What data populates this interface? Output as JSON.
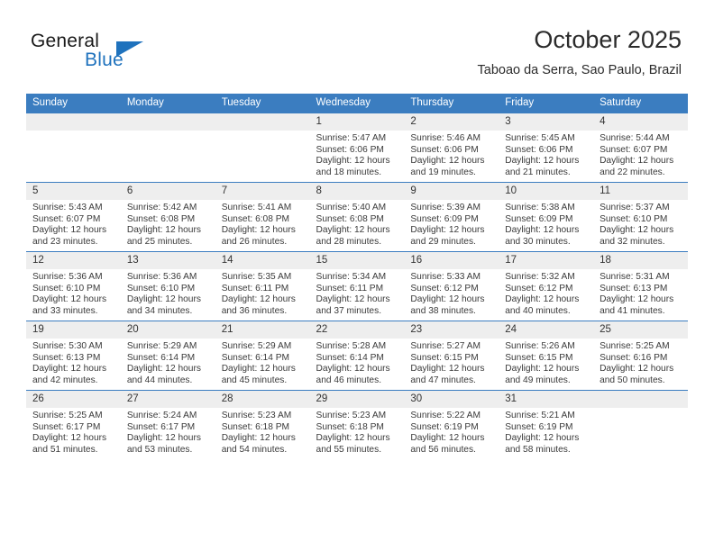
{
  "logo": {
    "word1": "General",
    "word2": "Blue",
    "accent_color": "#1f72bd"
  },
  "header": {
    "month_title": "October 2025",
    "location": "Taboao da Serra, Sao Paulo, Brazil"
  },
  "calendar": {
    "header_color": "#3b7dc0",
    "daynum_bg": "#eeeeee",
    "weekdays": [
      "Sunday",
      "Monday",
      "Tuesday",
      "Wednesday",
      "Thursday",
      "Friday",
      "Saturday"
    ],
    "weeks": [
      [
        {
          "day": "",
          "sunrise": "",
          "sunset": "",
          "daylight_line1": "",
          "daylight_line2": ""
        },
        {
          "day": "",
          "sunrise": "",
          "sunset": "",
          "daylight_line1": "",
          "daylight_line2": ""
        },
        {
          "day": "",
          "sunrise": "",
          "sunset": "",
          "daylight_line1": "",
          "daylight_line2": ""
        },
        {
          "day": "1",
          "sunrise": "Sunrise: 5:47 AM",
          "sunset": "Sunset: 6:06 PM",
          "daylight_line1": "Daylight: 12 hours",
          "daylight_line2": "and 18 minutes."
        },
        {
          "day": "2",
          "sunrise": "Sunrise: 5:46 AM",
          "sunset": "Sunset: 6:06 PM",
          "daylight_line1": "Daylight: 12 hours",
          "daylight_line2": "and 19 minutes."
        },
        {
          "day": "3",
          "sunrise": "Sunrise: 5:45 AM",
          "sunset": "Sunset: 6:06 PM",
          "daylight_line1": "Daylight: 12 hours",
          "daylight_line2": "and 21 minutes."
        },
        {
          "day": "4",
          "sunrise": "Sunrise: 5:44 AM",
          "sunset": "Sunset: 6:07 PM",
          "daylight_line1": "Daylight: 12 hours",
          "daylight_line2": "and 22 minutes."
        }
      ],
      [
        {
          "day": "5",
          "sunrise": "Sunrise: 5:43 AM",
          "sunset": "Sunset: 6:07 PM",
          "daylight_line1": "Daylight: 12 hours",
          "daylight_line2": "and 23 minutes."
        },
        {
          "day": "6",
          "sunrise": "Sunrise: 5:42 AM",
          "sunset": "Sunset: 6:08 PM",
          "daylight_line1": "Daylight: 12 hours",
          "daylight_line2": "and 25 minutes."
        },
        {
          "day": "7",
          "sunrise": "Sunrise: 5:41 AM",
          "sunset": "Sunset: 6:08 PM",
          "daylight_line1": "Daylight: 12 hours",
          "daylight_line2": "and 26 minutes."
        },
        {
          "day": "8",
          "sunrise": "Sunrise: 5:40 AM",
          "sunset": "Sunset: 6:08 PM",
          "daylight_line1": "Daylight: 12 hours",
          "daylight_line2": "and 28 minutes."
        },
        {
          "day": "9",
          "sunrise": "Sunrise: 5:39 AM",
          "sunset": "Sunset: 6:09 PM",
          "daylight_line1": "Daylight: 12 hours",
          "daylight_line2": "and 29 minutes."
        },
        {
          "day": "10",
          "sunrise": "Sunrise: 5:38 AM",
          "sunset": "Sunset: 6:09 PM",
          "daylight_line1": "Daylight: 12 hours",
          "daylight_line2": "and 30 minutes."
        },
        {
          "day": "11",
          "sunrise": "Sunrise: 5:37 AM",
          "sunset": "Sunset: 6:10 PM",
          "daylight_line1": "Daylight: 12 hours",
          "daylight_line2": "and 32 minutes."
        }
      ],
      [
        {
          "day": "12",
          "sunrise": "Sunrise: 5:36 AM",
          "sunset": "Sunset: 6:10 PM",
          "daylight_line1": "Daylight: 12 hours",
          "daylight_line2": "and 33 minutes."
        },
        {
          "day": "13",
          "sunrise": "Sunrise: 5:36 AM",
          "sunset": "Sunset: 6:10 PM",
          "daylight_line1": "Daylight: 12 hours",
          "daylight_line2": "and 34 minutes."
        },
        {
          "day": "14",
          "sunrise": "Sunrise: 5:35 AM",
          "sunset": "Sunset: 6:11 PM",
          "daylight_line1": "Daylight: 12 hours",
          "daylight_line2": "and 36 minutes."
        },
        {
          "day": "15",
          "sunrise": "Sunrise: 5:34 AM",
          "sunset": "Sunset: 6:11 PM",
          "daylight_line1": "Daylight: 12 hours",
          "daylight_line2": "and 37 minutes."
        },
        {
          "day": "16",
          "sunrise": "Sunrise: 5:33 AM",
          "sunset": "Sunset: 6:12 PM",
          "daylight_line1": "Daylight: 12 hours",
          "daylight_line2": "and 38 minutes."
        },
        {
          "day": "17",
          "sunrise": "Sunrise: 5:32 AM",
          "sunset": "Sunset: 6:12 PM",
          "daylight_line1": "Daylight: 12 hours",
          "daylight_line2": "and 40 minutes."
        },
        {
          "day": "18",
          "sunrise": "Sunrise: 5:31 AM",
          "sunset": "Sunset: 6:13 PM",
          "daylight_line1": "Daylight: 12 hours",
          "daylight_line2": "and 41 minutes."
        }
      ],
      [
        {
          "day": "19",
          "sunrise": "Sunrise: 5:30 AM",
          "sunset": "Sunset: 6:13 PM",
          "daylight_line1": "Daylight: 12 hours",
          "daylight_line2": "and 42 minutes."
        },
        {
          "day": "20",
          "sunrise": "Sunrise: 5:29 AM",
          "sunset": "Sunset: 6:14 PM",
          "daylight_line1": "Daylight: 12 hours",
          "daylight_line2": "and 44 minutes."
        },
        {
          "day": "21",
          "sunrise": "Sunrise: 5:29 AM",
          "sunset": "Sunset: 6:14 PM",
          "daylight_line1": "Daylight: 12 hours",
          "daylight_line2": "and 45 minutes."
        },
        {
          "day": "22",
          "sunrise": "Sunrise: 5:28 AM",
          "sunset": "Sunset: 6:14 PM",
          "daylight_line1": "Daylight: 12 hours",
          "daylight_line2": "and 46 minutes."
        },
        {
          "day": "23",
          "sunrise": "Sunrise: 5:27 AM",
          "sunset": "Sunset: 6:15 PM",
          "daylight_line1": "Daylight: 12 hours",
          "daylight_line2": "and 47 minutes."
        },
        {
          "day": "24",
          "sunrise": "Sunrise: 5:26 AM",
          "sunset": "Sunset: 6:15 PM",
          "daylight_line1": "Daylight: 12 hours",
          "daylight_line2": "and 49 minutes."
        },
        {
          "day": "25",
          "sunrise": "Sunrise: 5:25 AM",
          "sunset": "Sunset: 6:16 PM",
          "daylight_line1": "Daylight: 12 hours",
          "daylight_line2": "and 50 minutes."
        }
      ],
      [
        {
          "day": "26",
          "sunrise": "Sunrise: 5:25 AM",
          "sunset": "Sunset: 6:17 PM",
          "daylight_line1": "Daylight: 12 hours",
          "daylight_line2": "and 51 minutes."
        },
        {
          "day": "27",
          "sunrise": "Sunrise: 5:24 AM",
          "sunset": "Sunset: 6:17 PM",
          "daylight_line1": "Daylight: 12 hours",
          "daylight_line2": "and 53 minutes."
        },
        {
          "day": "28",
          "sunrise": "Sunrise: 5:23 AM",
          "sunset": "Sunset: 6:18 PM",
          "daylight_line1": "Daylight: 12 hours",
          "daylight_line2": "and 54 minutes."
        },
        {
          "day": "29",
          "sunrise": "Sunrise: 5:23 AM",
          "sunset": "Sunset: 6:18 PM",
          "daylight_line1": "Daylight: 12 hours",
          "daylight_line2": "and 55 minutes."
        },
        {
          "day": "30",
          "sunrise": "Sunrise: 5:22 AM",
          "sunset": "Sunset: 6:19 PM",
          "daylight_line1": "Daylight: 12 hours",
          "daylight_line2": "and 56 minutes."
        },
        {
          "day": "31",
          "sunrise": "Sunrise: 5:21 AM",
          "sunset": "Sunset: 6:19 PM",
          "daylight_line1": "Daylight: 12 hours",
          "daylight_line2": "and 58 minutes."
        },
        {
          "day": "",
          "sunrise": "",
          "sunset": "",
          "daylight_line1": "",
          "daylight_line2": ""
        }
      ]
    ]
  }
}
